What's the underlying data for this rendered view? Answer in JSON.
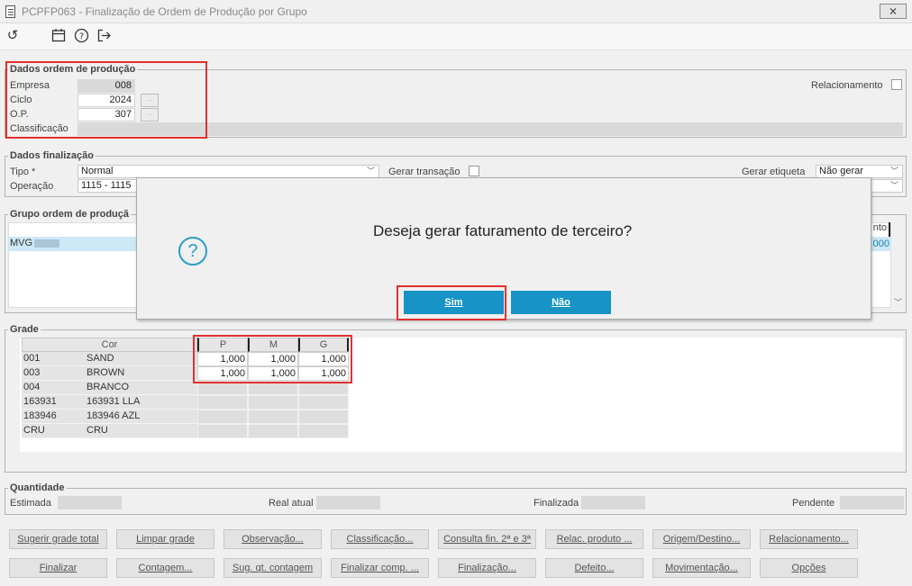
{
  "window": {
    "title": "PCPFP063 - Finalização de Ordem de Produção por Grupo",
    "close_label": "⨯"
  },
  "ordem": {
    "legend": "Dados ordem de produção",
    "empresa_label": "Empresa",
    "empresa_value": "008",
    "ciclo_label": "Ciclo",
    "ciclo_value": "2024",
    "op_label": "O.P.",
    "op_value": "307",
    "classificacao_label": "Classificação",
    "relacionamento_label": "Relacionamento"
  },
  "finalizacao": {
    "legend": "Dados finalização",
    "tipo_label": "Tipo *",
    "tipo_value": "Normal",
    "gerar_transacao_label": "Gerar transação",
    "gerar_etiqueta_label": "Gerar etiqueta",
    "gerar_etiqueta_value": "Não gerar",
    "operacao_label": "Operação",
    "operacao_value": "1115 - 1115"
  },
  "grupo": {
    "legend": "Grupo ordem de produçã",
    "first_row": "MVG",
    "right_col_header": "nto",
    "right_col_value": "000"
  },
  "grade": {
    "legend": "Grade",
    "cor_header": "Cor",
    "sizes": [
      "P",
      "M",
      "G"
    ],
    "rows": [
      {
        "code": "001",
        "name": "SAND",
        "values": [
          "1,000",
          "1,000",
          "1,000"
        ]
      },
      {
        "code": "003",
        "name": "BROWN",
        "values": [
          "1,000",
          "1,000",
          "1,000"
        ]
      },
      {
        "code": "004",
        "name": "BRANCO",
        "values": [
          "",
          "",
          ""
        ]
      },
      {
        "code": "163931",
        "name": "163931 LLA",
        "values": [
          "",
          "",
          ""
        ]
      },
      {
        "code": "183946",
        "name": "183946 AZL",
        "values": [
          "",
          "",
          ""
        ]
      },
      {
        "code": "CRU",
        "name": "CRU",
        "values": [
          "",
          "",
          ""
        ]
      }
    ]
  },
  "quantidade": {
    "legend": "Quantidade",
    "estimada_label": "Estimada",
    "real_label": "Real atual",
    "finalizada_label": "Finalizada",
    "pendente_label": "Pendente"
  },
  "buttons_row1": [
    "Sugerir grade total",
    "Limpar grade",
    "Observação...",
    "Classificação...",
    "Consulta fin. 2ª e 3ª",
    "Relac. produto ...",
    "Origem/Destino...",
    "Relacionamento..."
  ],
  "buttons_row2": [
    "Finalizar",
    "Contagem...",
    "Sug. qt. contagem",
    "Finalizar comp. ...",
    "Finalização...",
    "Defeito...",
    "Movimentação...",
    "Opções"
  ],
  "dialog": {
    "message": "Deseja gerar faturamento de terceiro?",
    "yes_label": "Sim",
    "no_label": "Não"
  },
  "colors": {
    "dialog_button": "#1794c5",
    "highlight": "#e03030",
    "selected_row": "#cde8f6"
  }
}
